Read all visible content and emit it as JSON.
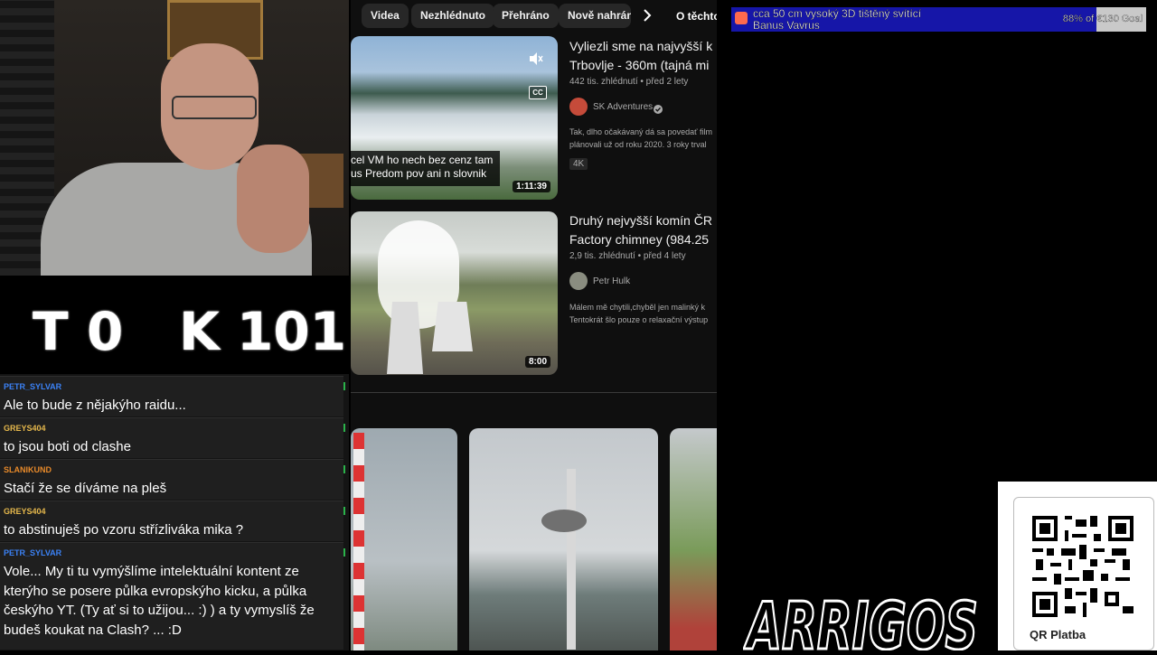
{
  "scoreboard": {
    "left_letter": "T",
    "left_score": "0",
    "right_letter": "K",
    "right_score": "101"
  },
  "chat": {
    "messages": [
      {
        "user": "PETR_SYLVAR",
        "color": "#3b82f6",
        "text": "Ale to bude z nějakýho raidu..."
      },
      {
        "user": "GREYS404",
        "color": "#e6b84c",
        "text": "to jsou boti od clashe"
      },
      {
        "user": "SLANIKUND",
        "color": "#e88a2a",
        "text": "Stačí že se díváme na pleš"
      },
      {
        "user": "GREYS404",
        "color": "#e6b84c",
        "text": "to abstinuješ po vzoru střízliváka mika ?"
      },
      {
        "user": "PETR_SYLVAR",
        "color": "#3b82f6",
        "text": "Vole... My ti tu vymýšlíme intelektuální kontent ze kterýho se posere půlka evropskýho kicku, a půlka českýho YT. (Ty ať si to užijou... :) ) a ty vymyslíš že budeš koukat na Clash? ... :D"
      }
    ]
  },
  "youtube": {
    "chips": [
      "Videa",
      "Nezhlédnuto",
      "Přehráno",
      "Nově nahrán"
    ],
    "chips_next_icon": "chevron-right-icon",
    "about_label": "O těchto",
    "videos": [
      {
        "title_line1": "Vyliezli sme na najvyšší k",
        "title_line2": "Trbovlje - 360m (tajná mi",
        "meta": "442 tis. zhlédnutí • před 2 lety",
        "channel": "SK Adventures",
        "verified": true,
        "desc_line1": "Tak, dlho očakávaný dá sa povedať film",
        "desc_line2": "plánovali už od roku 2020. 3 roky trval",
        "badge": "4K",
        "duration": "1:11:39",
        "subtitle_line1": "cel VM ho nech bez cenz tam",
        "subtitle_line2": "us Predom pov ani n slovnik",
        "cc_label": "CC"
      },
      {
        "title_line1": "Druhý nejvyšší komín ČR",
        "title_line2": "Factory chimney (984.25",
        "meta": "2,9 tis. zhlédnutí • před 4 lety",
        "channel": "Petr Hulk",
        "desc_line1": "Málem mě chytili,chyběl jen malinký k",
        "desc_line2": "Tentokrát šlo pouze o relaxační výstup",
        "duration": "8:00"
      }
    ]
  },
  "goal": {
    "text_line1": "cca 50 cm vysoký 3D tištěný svítící",
    "text_line2": "Banus Vavrus",
    "progress_text": "88% of €130 Goal",
    "progress_fraction": 0.88
  },
  "logo": {
    "text": "ARRIGOS"
  },
  "qr": {
    "label": "QR Platba"
  }
}
